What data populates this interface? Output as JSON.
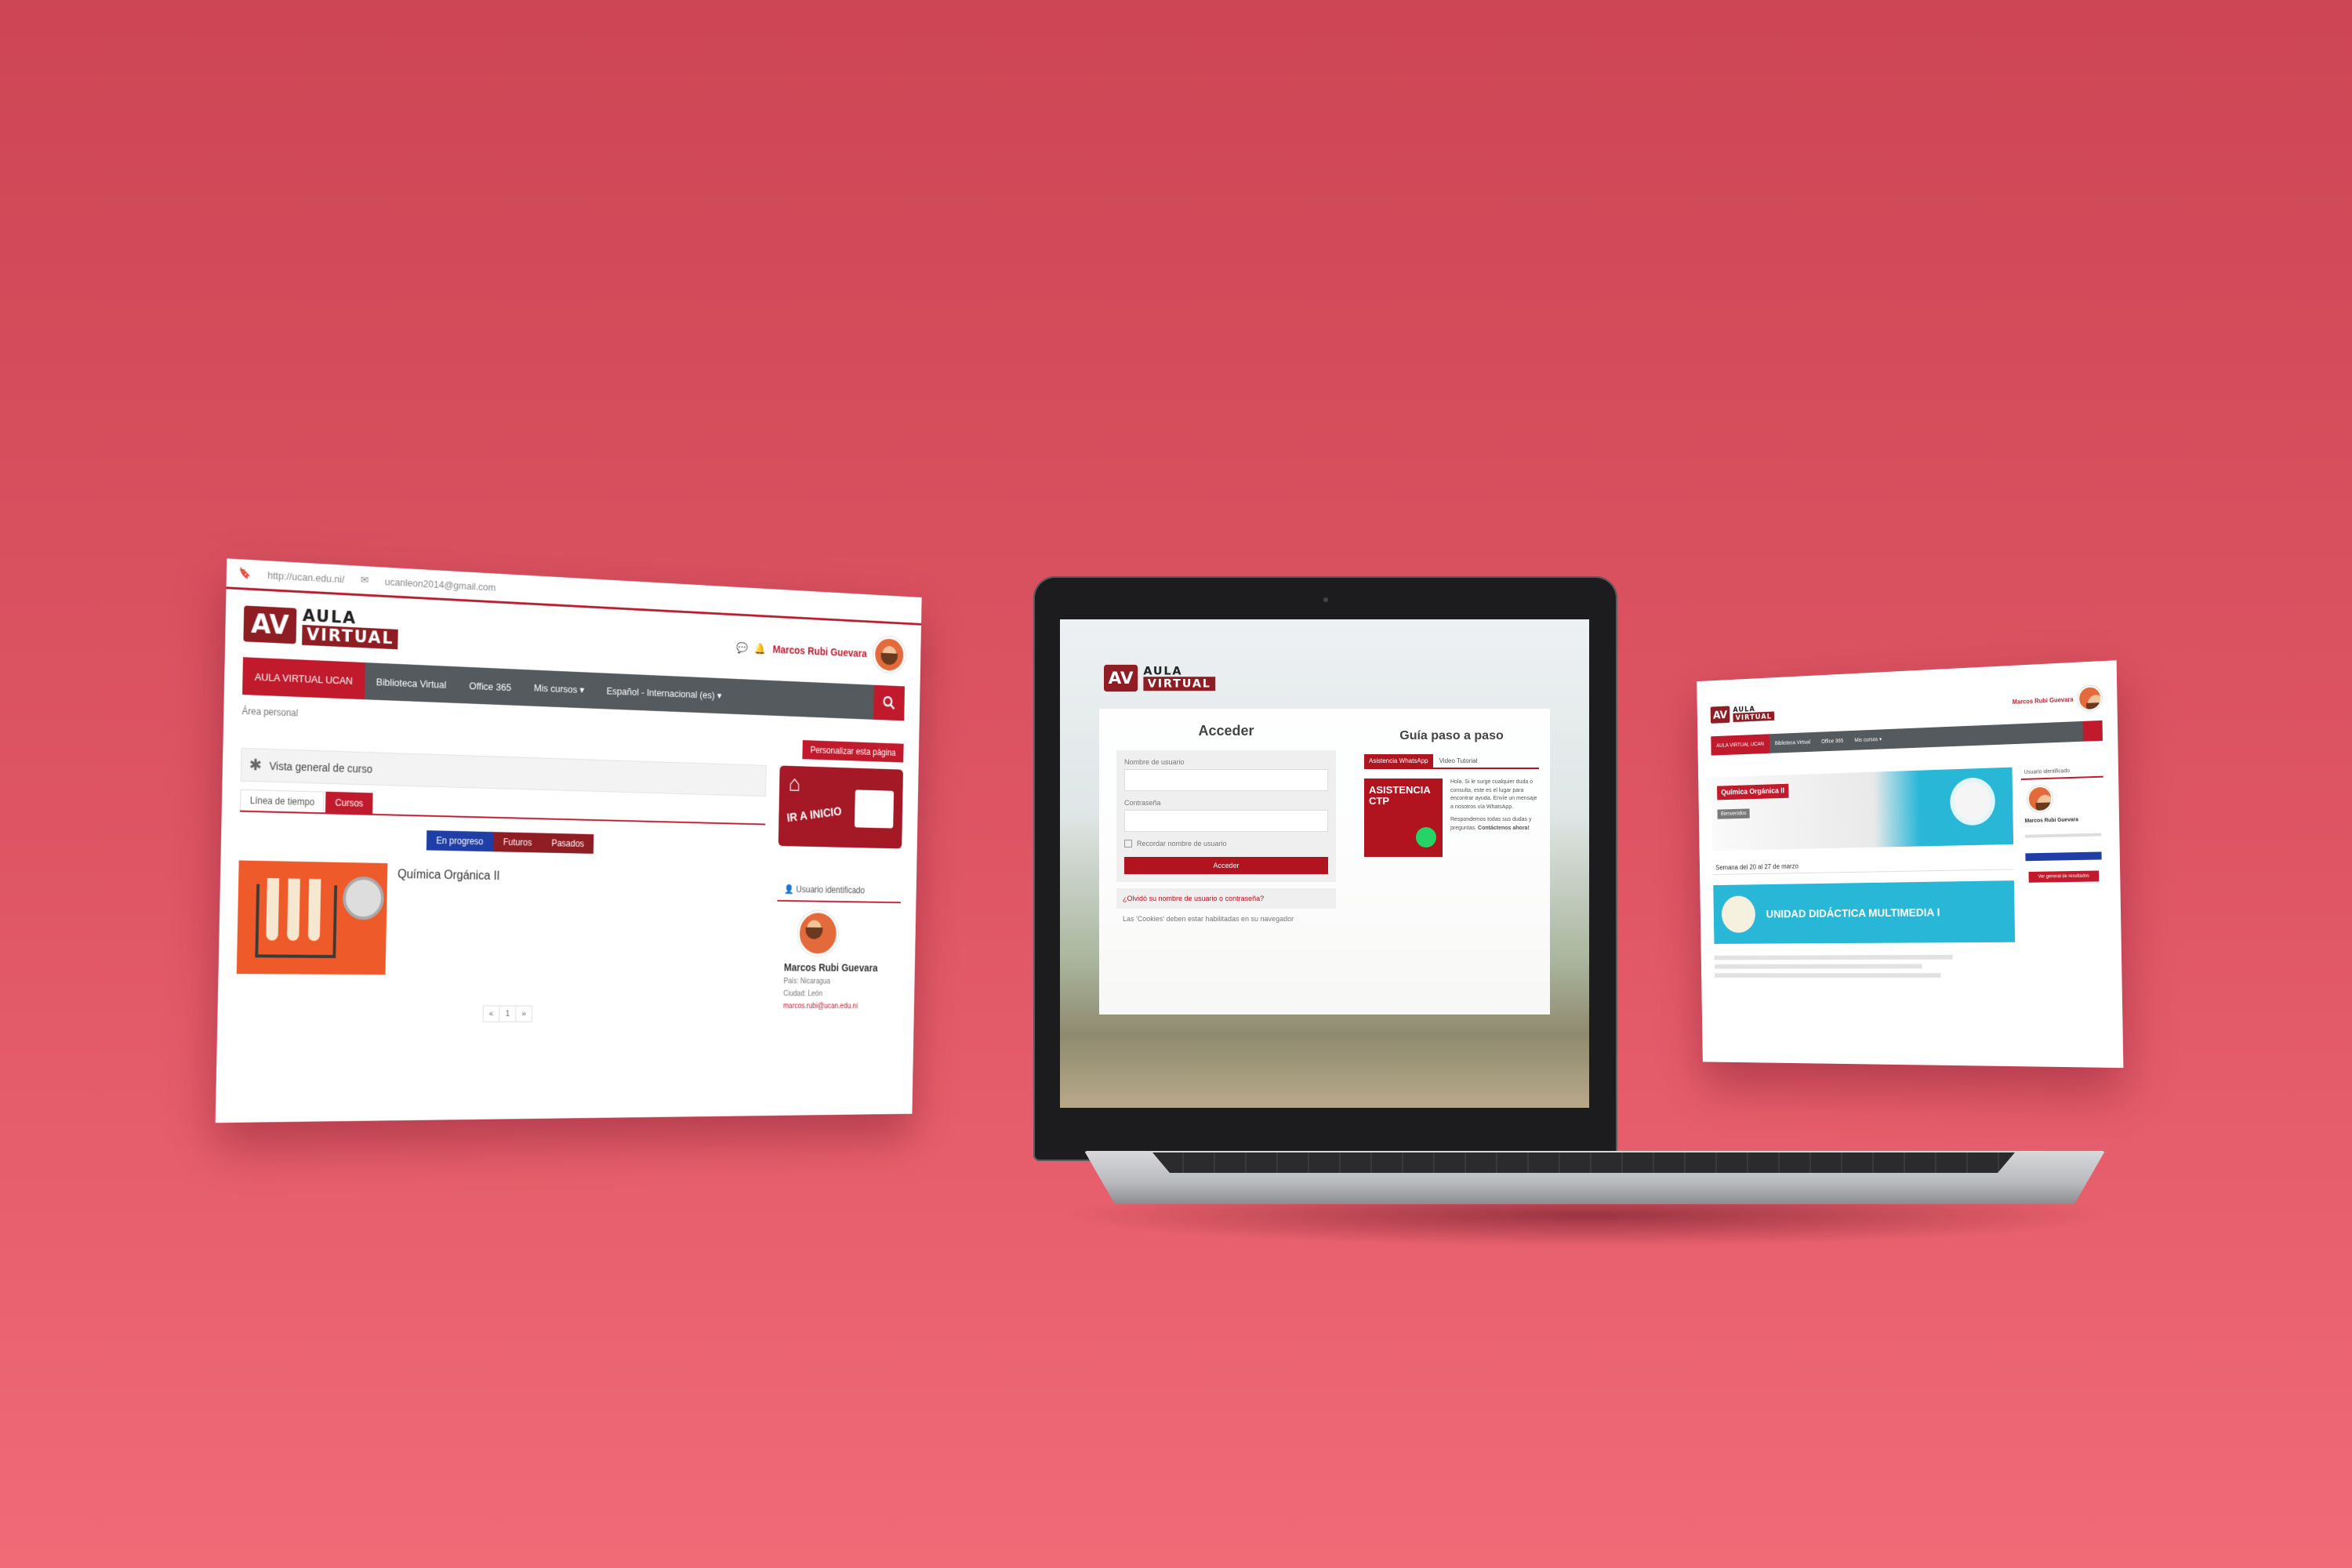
{
  "left_screen": {
    "topbar": {
      "url": "http://ucan.edu.ni/",
      "email": "ucanleon2014@gmail.com"
    },
    "logo": {
      "av": "AV",
      "line1": "AULA",
      "line2": "VIRTUAL"
    },
    "user_name": "Marcos Rubi Guevara",
    "nav": [
      "AULA VIRTUAL UCAN",
      "Biblioteca Virtual",
      "Office 365",
      "Mis cursos ▾",
      "Español - Internacional (es) ▾"
    ],
    "breadcrumb": "Área personal",
    "customize_button": "Personalizar esta página",
    "overview_title": "Vista general de curso",
    "tabs": [
      "Línea de tiempo",
      "Cursos"
    ],
    "filters": [
      "En progreso",
      "Futuros",
      "Pasados"
    ],
    "course_title": "Química Orgánica II",
    "pagination": [
      "«",
      "1",
      "»"
    ],
    "banner_text": "IR A INICIO",
    "user_block": {
      "title": "Usuario identificado",
      "name": "Marcos Rubi Guevara",
      "country": "País: Nicaragua",
      "city": "Ciudad: León",
      "email": "marcos.rubi@ucan.edu.ni"
    }
  },
  "laptop_screen": {
    "logo": {
      "av": "AV",
      "line1": "AULA",
      "line2": "VIRTUAL"
    },
    "login_title": "Acceder",
    "username_label": "Nombre de usuario",
    "password_label": "Contraseña",
    "remember_label": "Recordar nombre de usuario",
    "submit_label": "Acceder",
    "forgot_link": "¿Olvidó su nombre de usuario o contraseña?",
    "cookies_note": "Las 'Cookies' deben estar habilitadas en su navegador",
    "guide_title": "Guía paso a paso",
    "guide_tabs": [
      "Asistencia WhatsApp",
      "Video Tutorial"
    ],
    "guide_image_text": "ASISTENCIA CTP",
    "guide_text": "Hola. Si le surge cualquier duda o consulta, este es el lugar para encontrar ayuda. Envíe un mensaje a nosotros vía WhatsApp.",
    "guide_footer": "Respondemos todas sus dudas y preguntas.",
    "guide_cta": "Contáctenos ahora!"
  },
  "right_screen": {
    "logo": {
      "av": "AV",
      "line1": "AULA",
      "line2": "VIRTUAL"
    },
    "user_name": "Marcos Rubi Guevara",
    "nav": [
      "AULA VIRTUAL UCAN",
      "Biblioteca Virtual",
      "Office 365",
      "Mis cursos ▾"
    ],
    "course_title": "Química Orgánica II",
    "course_tag": "Bienvenidos",
    "week_title": "Semana del 20 al 27 de marzo",
    "unit_banner": "UNIDAD DIDÁCTICA MULTIMEDIA I",
    "user_block_title": "Usuario identificado",
    "user_block_name": "Marcos Rubi Guevara",
    "side_button": "Ver general de resultados"
  }
}
